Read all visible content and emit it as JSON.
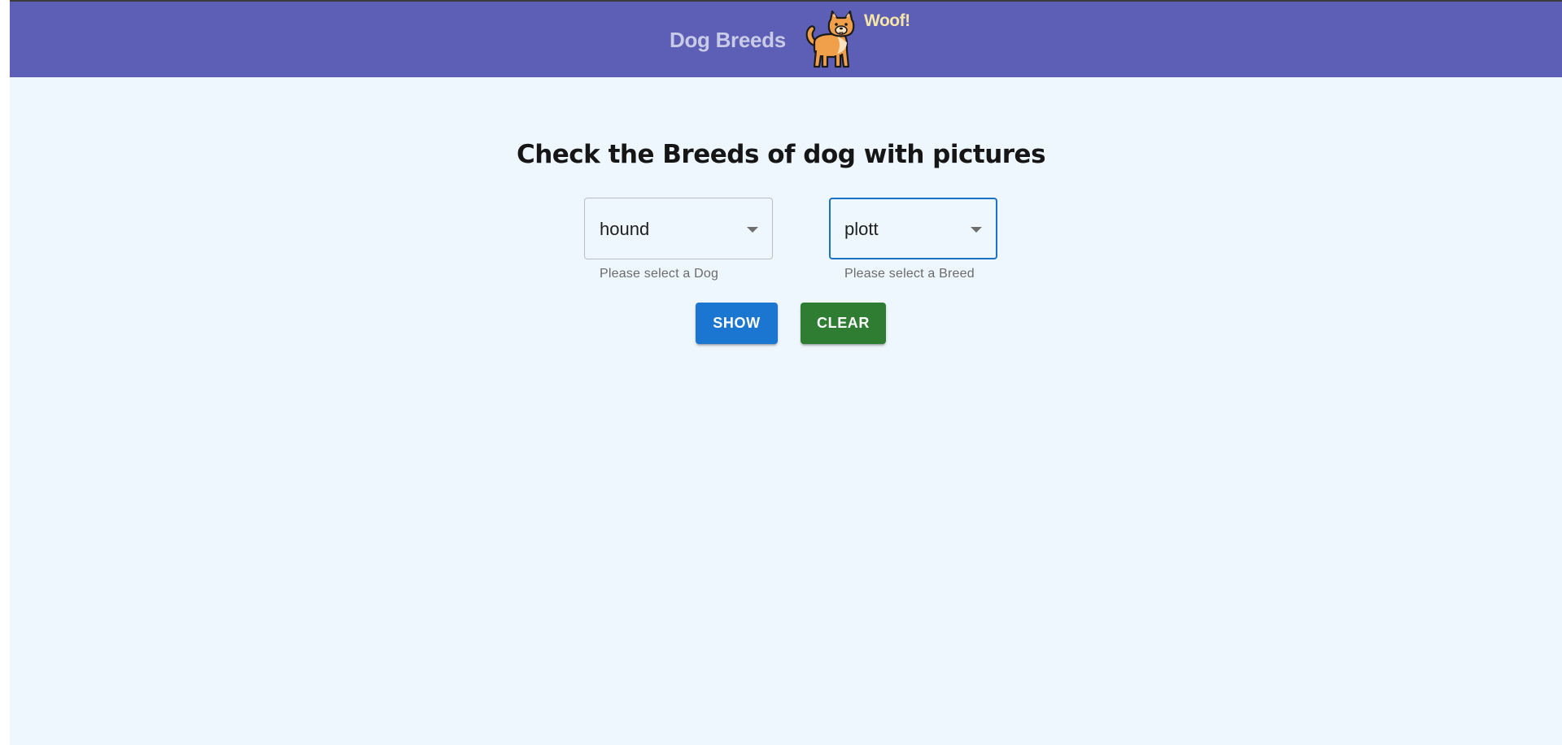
{
  "header": {
    "title": "Dog Breeds",
    "badge_text": "Woof!",
    "logo_icon": "dog-icon",
    "background_color": "#5c5fb5"
  },
  "main": {
    "heading": "Check the Breeds of dog with pictures",
    "background_color": "#eef7fd",
    "dog_select": {
      "value": "hound",
      "helper_text": "Please select a Dog"
    },
    "breed_select": {
      "value": "plott",
      "helper_text": "Please select a Breed"
    },
    "buttons": {
      "show_label": "SHOW",
      "show_color": "#1b76d2",
      "clear_label": "CLEAR",
      "clear_color": "#2e7d32"
    }
  }
}
